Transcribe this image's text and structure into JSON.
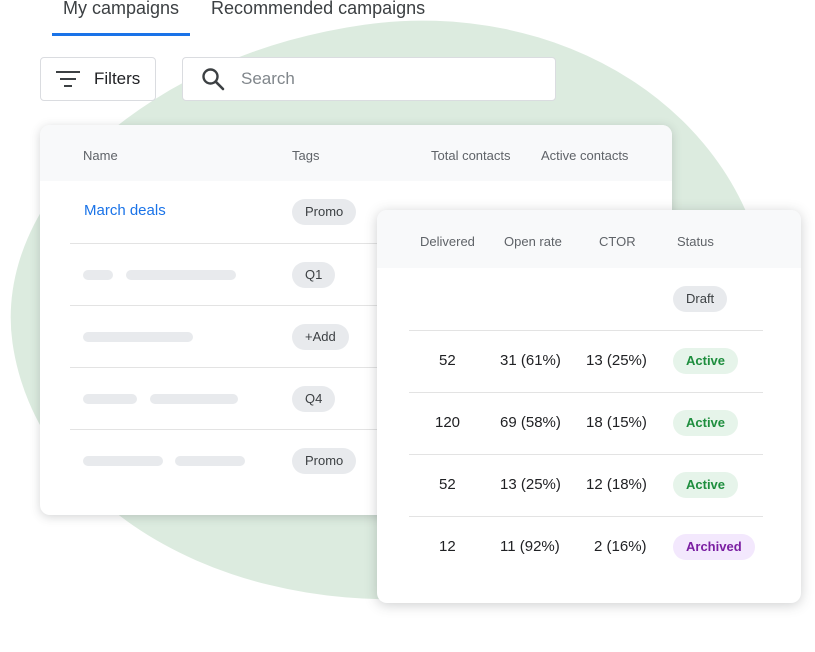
{
  "tabs": [
    {
      "label": "My campaigns",
      "active": true
    },
    {
      "label": "Recommended campaigns",
      "active": false
    }
  ],
  "toolbar": {
    "filters_label": "Filters",
    "search_placeholder": "Search",
    "search_value": ""
  },
  "campaigns_table": {
    "columns": [
      "Name",
      "Tags",
      "Total contacts",
      "Active contacts"
    ],
    "rows": [
      {
        "name": "March deals",
        "tag": "Promo"
      },
      {
        "name": "",
        "tag": "Q1"
      },
      {
        "name": "",
        "tag": "+Add"
      },
      {
        "name": "",
        "tag": "Q4"
      },
      {
        "name": "",
        "tag": "Promo"
      }
    ]
  },
  "stats_table": {
    "columns": [
      "Delivered",
      "Open rate",
      "CTOR",
      "Status"
    ],
    "rows": [
      {
        "delivered": "",
        "open_rate": "",
        "ctor": "",
        "status": "Draft",
        "status_type": "draft"
      },
      {
        "delivered": "52",
        "open_rate": "31 (61%)",
        "ctor": "13 (25%)",
        "status": "Active",
        "status_type": "active"
      },
      {
        "delivered": "120",
        "open_rate": "69 (58%)",
        "ctor": "18 (15%)",
        "status": "Active",
        "status_type": "active"
      },
      {
        "delivered": "52",
        "open_rate": "13 (25%)",
        "ctor": "12 (18%)",
        "status": "Active",
        "status_type": "active"
      },
      {
        "delivered": "12",
        "open_rate": "11 (92%)",
        "ctor": "2 (16%)",
        "status": "Archived",
        "status_type": "archived"
      }
    ]
  },
  "colors": {
    "accent": "#1a73e8",
    "background_blob": "#dcebdf",
    "active_badge": "#e6f4ea",
    "archived_badge": "#f3e8fd"
  },
  "icons": {
    "filter": "filter-list-icon",
    "search": "search-icon"
  }
}
